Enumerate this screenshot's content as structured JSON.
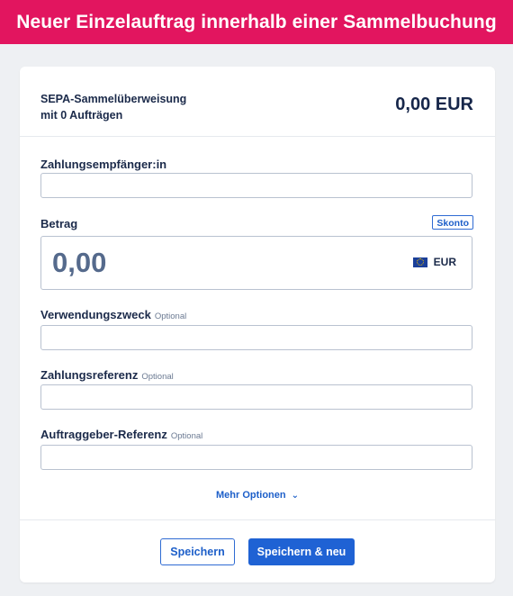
{
  "header": {
    "title": "Neuer Einzelauftrag innerhalb einer Sammelbuchung"
  },
  "summary": {
    "line1": "SEPA-Sammelüberweisung",
    "line2": "mit 0 Aufträgen",
    "total": "0,00 EUR"
  },
  "form": {
    "recipient": {
      "label": "Zahlungsempfänger:in",
      "value": ""
    },
    "amount": {
      "label": "Betrag",
      "skonto": "Skonto",
      "value": "0,00",
      "currency": "EUR",
      "currency_icon": "eu-flag-icon"
    },
    "purpose": {
      "label": "Verwendungszweck",
      "optional": "Optional",
      "value": ""
    },
    "reference": {
      "label": "Zahlungsreferenz",
      "optional": "Optional",
      "value": ""
    },
    "client_reference": {
      "label": "Auftraggeber-Referenz",
      "optional": "Optional",
      "value": ""
    },
    "more_options": "Mehr Optionen",
    "more_icon": "chevron-down-icon"
  },
  "actions": {
    "save": "Speichern",
    "save_new": "Speichern & neu"
  },
  "colors": {
    "brand": "#e2155f",
    "primary": "#1f62d4"
  }
}
